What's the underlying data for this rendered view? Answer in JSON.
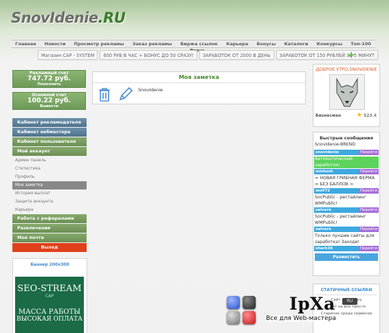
{
  "logo": {
    "main": "SnovIdenie",
    "suffix": ".RU"
  },
  "nav": [
    "Главная",
    "Новости",
    "Просмотр рекламы",
    "Заказ рекламы",
    "Биржа ссылок",
    "Карьера",
    "Бонусы",
    "Каталоги",
    "Конкурсы",
    "Топ-100"
  ],
  "ticker": {
    "label": "Форум",
    "items": [
      "Магазин САР - SYSTEM",
      "600 РУБ В ЧАС + БОНУС ДО 50 СРАЗУ!",
      "ЗАРАБОТОК ОТ 2000 В ДЕНЬ",
      "ЗАРАБОТОК ОТ 150 РУБЛЕЙ ЗА 5 МИНУТ"
    ]
  },
  "balances": {
    "ad": {
      "label": "Рекламный счет",
      "value": "747.72 руб.",
      "action": "Пополнить"
    },
    "main": {
      "label": "Основной счет",
      "value": "100.22 руб.",
      "action": "Вывести"
    }
  },
  "leftmenu": {
    "cabinets": [
      "Кабинет рекламодателя",
      "Кабинет вебмастера",
      "Кабинет пользователя"
    ],
    "myaccount": "Мой аккаунт",
    "subitems": [
      "Админ панель",
      "Статистика",
      "Профиль",
      "Моя заметка",
      "История выплат",
      "Защита аккаунта",
      "Карьера"
    ],
    "active_index": 3,
    "sections": [
      "Работа с рефералами",
      "Развлечения",
      "Моя почта"
    ],
    "exit": "Выход"
  },
  "banner": {
    "title": "Баннер 200x300",
    "brand": "SEO-STREAM",
    "sub": "CAP",
    "line1": "МАССА РАБОТЫ",
    "line2": "ВЫСОКАЯ ОПЛАТА"
  },
  "note": {
    "title": "Моя заметка",
    "text": "SnovIdenie",
    "icons": [
      "trash-icon",
      "pencil-icon"
    ]
  },
  "profile": {
    "greeting": "ДОБРОЕ УТРО,SNOVIDENIE",
    "status": "Бизнесмен",
    "rating": "523.4"
  },
  "quick": {
    "title": "Быстрые сообщения",
    "reply": "Перейти",
    "messages": [
      {
        "text": "SnovIdenie-BREND",
        "user": "snovidenie",
        "highlight": false
      },
      {
        "text": "Автоматический заработок!",
        "user": "mishoot",
        "highlight": true
      },
      {
        "text": "= НОВАЯ ГРИБНАЯ ФЕРМА = БЕЗ БАЛЛОВ =",
        "user": "wolf72",
        "highlight": false
      },
      {
        "text": "SocPublic - рестайлинг WMPublic!",
        "user": "salvare",
        "highlight": false
      },
      {
        "text": "SocPublic - рестайлинг WMPublic!",
        "user": "salvare",
        "highlight": false
      },
      {
        "text": "Только лучшие сайты для заработка! Заходи!",
        "user": "shark36",
        "highlight": false
      }
    ],
    "post": "Разместить"
  },
  "static_links": {
    "title": "СТАТИЧНЫЕ ССЫЛКИ",
    "items": [
      "Сайт на ссылку",
      "Сайт на все просто",
      "Старичок среди сервисов"
    ]
  },
  "overlay": {
    "brand": "IpXa",
    "badge": "RU",
    "tagline": "Все для Web-мастера"
  },
  "colors": {
    "green": "#6d9a58",
    "blue": "#4f7490",
    "exit": "#e0401a",
    "title_green": "#4b8a2e",
    "link_blue": "#3a8ad0"
  }
}
